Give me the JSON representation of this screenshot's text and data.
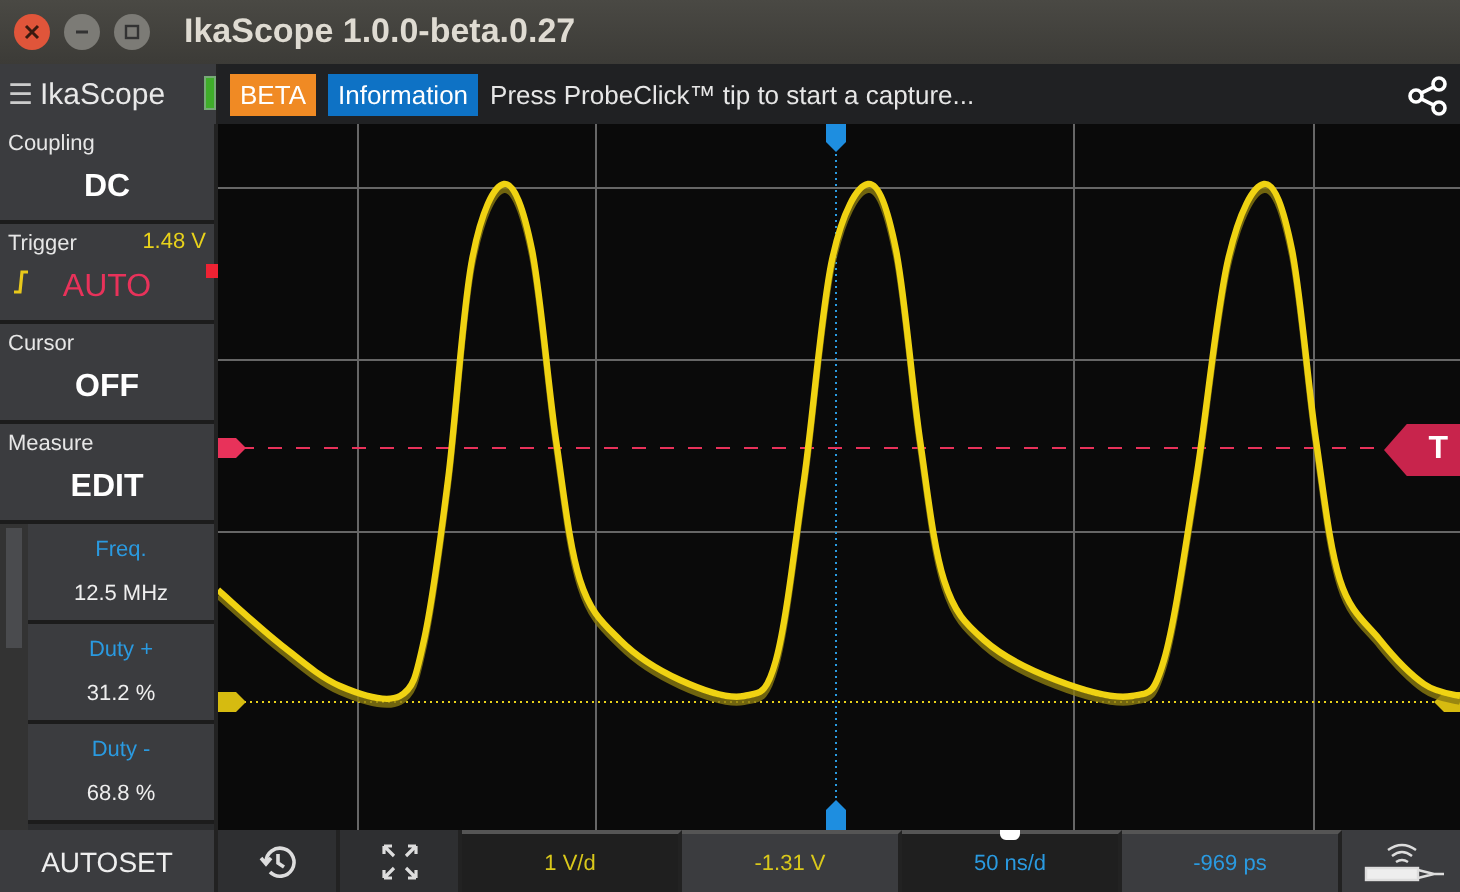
{
  "window": {
    "title": "IkaScope 1.0.0-beta.0.27"
  },
  "app_menu": {
    "icon": "☰",
    "label": "IkaScope"
  },
  "toolbar": {
    "badges": [
      {
        "text": "BETA",
        "kind": "beta"
      },
      {
        "text": "Information",
        "kind": "info"
      }
    ],
    "message": "Press ProbeClick™ tip to start a capture..."
  },
  "sidebar": {
    "controls": [
      {
        "label": "Coupling",
        "value": "DC",
        "kind": "plain"
      },
      {
        "label": "Trigger",
        "value": "AUTO",
        "reading": "1.48 V",
        "kind": "trigger"
      },
      {
        "label": "Cursor",
        "value": "OFF",
        "kind": "plain"
      },
      {
        "label": "Measure",
        "value": "EDIT",
        "kind": "plain"
      }
    ],
    "measurements": [
      {
        "name": "Freq.",
        "value": "12.5 MHz"
      },
      {
        "name": "Duty +",
        "value": "31.2 %"
      },
      {
        "name": "Duty -",
        "value": "68.8 %"
      }
    ]
  },
  "plot": {
    "trigger_marker": "T"
  },
  "bottom_bar": {
    "autoset": "AUTOSET",
    "readouts": [
      {
        "text": "1 V/d",
        "kind": "volt"
      },
      {
        "text": "-1.31 V",
        "kind": "volt"
      },
      {
        "text": "50 ns/d",
        "kind": "time"
      },
      {
        "text": "-969 ps",
        "kind": "time"
      }
    ]
  }
}
